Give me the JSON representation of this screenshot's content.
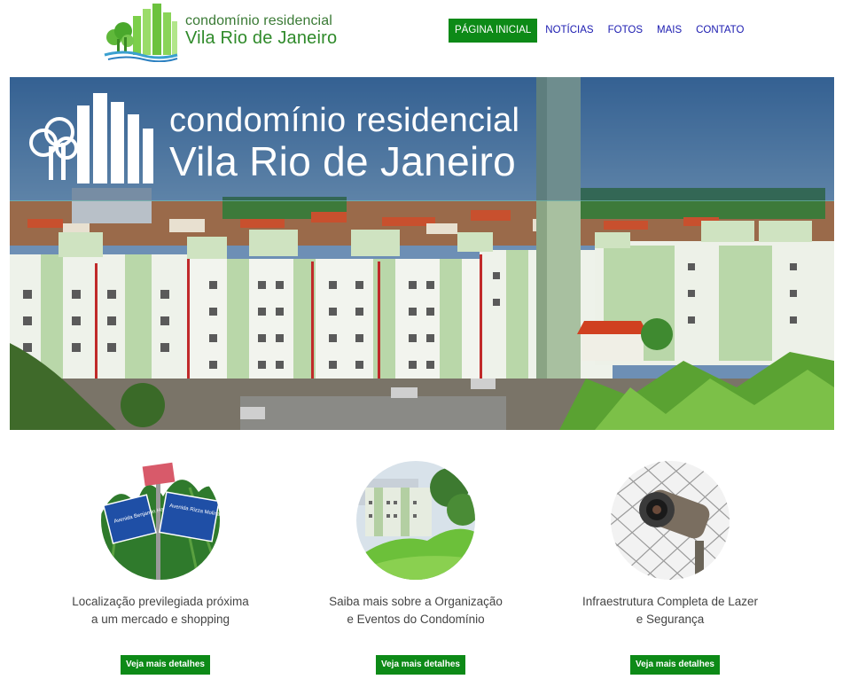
{
  "header": {
    "logo_line1": "condomínio residencial",
    "logo_line2": "Vila Rio de Janeiro"
  },
  "nav": [
    {
      "label": "PÁGINA INICIAL",
      "active": true
    },
    {
      "label": "NOTÍCIAS",
      "active": false
    },
    {
      "label": "FOTOS",
      "active": false
    },
    {
      "label": "MAIS",
      "active": false
    },
    {
      "label": "CONTATO",
      "active": false
    }
  ],
  "hero": {
    "line1": "condomínio residencial",
    "line2": "Vila Rio de Janeiro"
  },
  "features": [
    {
      "caption_line1": "Localização previlegiada próxima",
      "caption_line2": "a um mercado e shopping",
      "button": "Veja mais detalhes",
      "sign1": "Avenida Benjamin Harris Hunnicutt",
      "sign2": "Avenida Rizza Molina Pannocchia"
    },
    {
      "caption_line1": "Saiba mais sobre a Organização",
      "caption_line2": "e Eventos do Condomínio",
      "button": "Veja mais detalhes"
    },
    {
      "caption_line1": "Infraestrutura Completa de Lazer",
      "caption_line2": "e Segurança",
      "button": "Veja mais detalhes"
    }
  ],
  "colors": {
    "brand_green": "#0d8a17",
    "nav_link": "#1a1ab0"
  }
}
